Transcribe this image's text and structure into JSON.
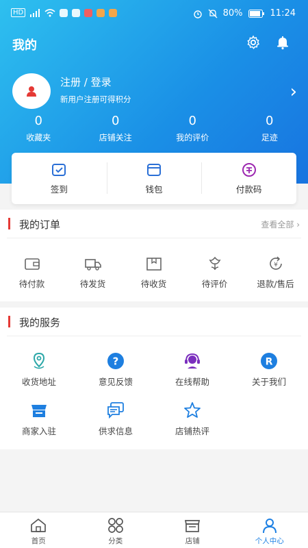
{
  "statusbar": {
    "network": "HD",
    "battery": "80%",
    "time": "11:24"
  },
  "header": {
    "title": "我的"
  },
  "profile": {
    "name": "注册 / 登录",
    "subtitle": "新用户注册可得积分"
  },
  "stats": [
    {
      "value": "0",
      "label": "收藏夹"
    },
    {
      "value": "0",
      "label": "店铺关注"
    },
    {
      "value": "0",
      "label": "我的评价"
    },
    {
      "value": "0",
      "label": "足迹"
    }
  ],
  "quick": [
    {
      "label": "签到",
      "icon": "checkin-icon"
    },
    {
      "label": "钱包",
      "icon": "wallet-icon"
    },
    {
      "label": "付款码",
      "icon": "pay-code-icon"
    }
  ],
  "orders": {
    "title": "我的订单",
    "more": "查看全部 ›",
    "items": [
      {
        "label": "待付款",
        "icon": "pending-payment-icon"
      },
      {
        "label": "待发货",
        "icon": "truck-icon"
      },
      {
        "label": "待收货",
        "icon": "package-icon"
      },
      {
        "label": "待评价",
        "icon": "flower-icon"
      },
      {
        "label": "退款/售后",
        "icon": "refund-icon"
      }
    ]
  },
  "services": {
    "title": "我的服务",
    "items": [
      {
        "label": "收货地址",
        "icon": "location-icon"
      },
      {
        "label": "意见反馈",
        "icon": "question-icon"
      },
      {
        "label": "在线帮助",
        "icon": "headset-icon"
      },
      {
        "label": "关于我们",
        "icon": "r-icon"
      },
      {
        "label": "商家入驻",
        "icon": "store-icon"
      },
      {
        "label": "供求信息",
        "icon": "chat-icon"
      },
      {
        "label": "店铺热评",
        "icon": "star-icon"
      }
    ]
  },
  "tabs": [
    {
      "label": "首页",
      "icon": "home-icon"
    },
    {
      "label": "分类",
      "icon": "category-icon"
    },
    {
      "label": "店铺",
      "icon": "shop-icon"
    },
    {
      "label": "个人中心",
      "icon": "user-icon"
    }
  ],
  "colors": {
    "accent": "#1b7fe3",
    "header_start": "#2ec0ef",
    "header_end": "#1874e0",
    "section_bar": "#e53935"
  }
}
